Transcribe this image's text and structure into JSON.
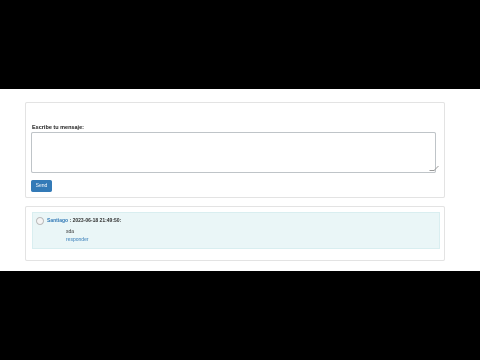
{
  "form": {
    "label": "Escribe tu mensaje:",
    "textarea_value": "",
    "send_label": "Send"
  },
  "comments": [
    {
      "author": "Santiago",
      "separator": " : ",
      "timestamp": "2023-06-18 21:49:50:",
      "text": "sda",
      "reply_label": "responder"
    }
  ],
  "colors": {
    "button": "#337ab7",
    "comment_bg": "#eaf6f7",
    "link": "#337ab7"
  },
  "icons": {
    "avatar": "user-avatar-icon"
  }
}
